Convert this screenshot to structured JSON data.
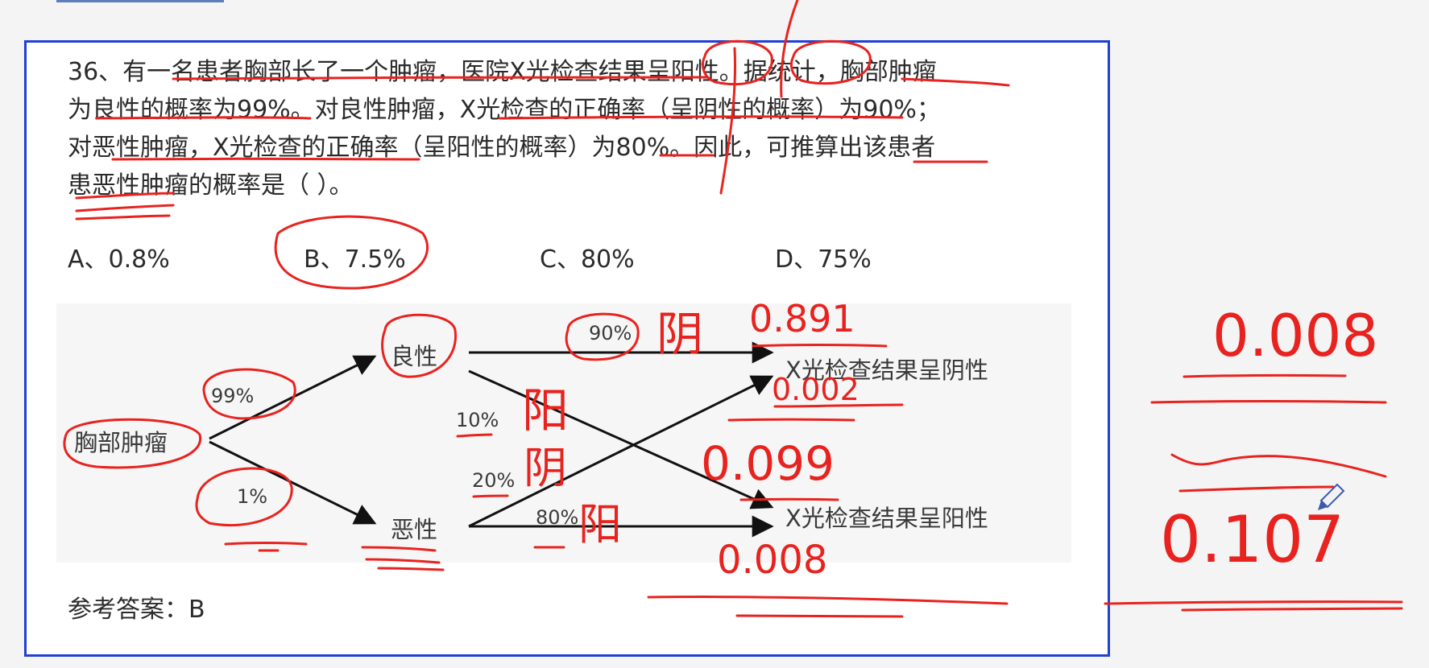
{
  "question": {
    "lines": [
      "36、有一名患者胸部长了一个肿瘤，医院X光检查结果呈阳性。据统计，胸部肿瘤",
      "为良性的概率为99%。对良性肿瘤，X光检查的正确率（呈阴性的概率）为90%；",
      "对恶性肿瘤，X光检查的正确率（呈阳性的概率）为80%。因此，可推算出该患者",
      "患恶性肿瘤的概率是（ ）。"
    ]
  },
  "options": [
    {
      "label": "A、0.8%"
    },
    {
      "label": "B、7.5%"
    },
    {
      "label": "C、80%"
    },
    {
      "label": "D、75%"
    }
  ],
  "diagram": {
    "root": "胸部肿瘤",
    "benign": "良性",
    "malignant": "恶性",
    "p_benign": "99%",
    "p_malignant": "1%",
    "benign_neg": "90%",
    "benign_pos": "10%",
    "malignant_neg": "20%",
    "malignant_pos": "80%",
    "result_neg": "X光检查结果呈阴性",
    "result_pos": "X光检查结果呈阳性"
  },
  "answer": "参考答案：B",
  "handwriting": {
    "yin1": "阴",
    "yang1": "阳",
    "yin2": "阴",
    "yang2": "阳",
    "v1": "0.891",
    "v2": "0.002",
    "v3": "0.099",
    "v4": "0.008",
    "sum_top": "0.008",
    "sum_bottom": "0.107",
    "colors": {
      "ink": "#e8231f",
      "border": "#1f3fd6"
    }
  }
}
